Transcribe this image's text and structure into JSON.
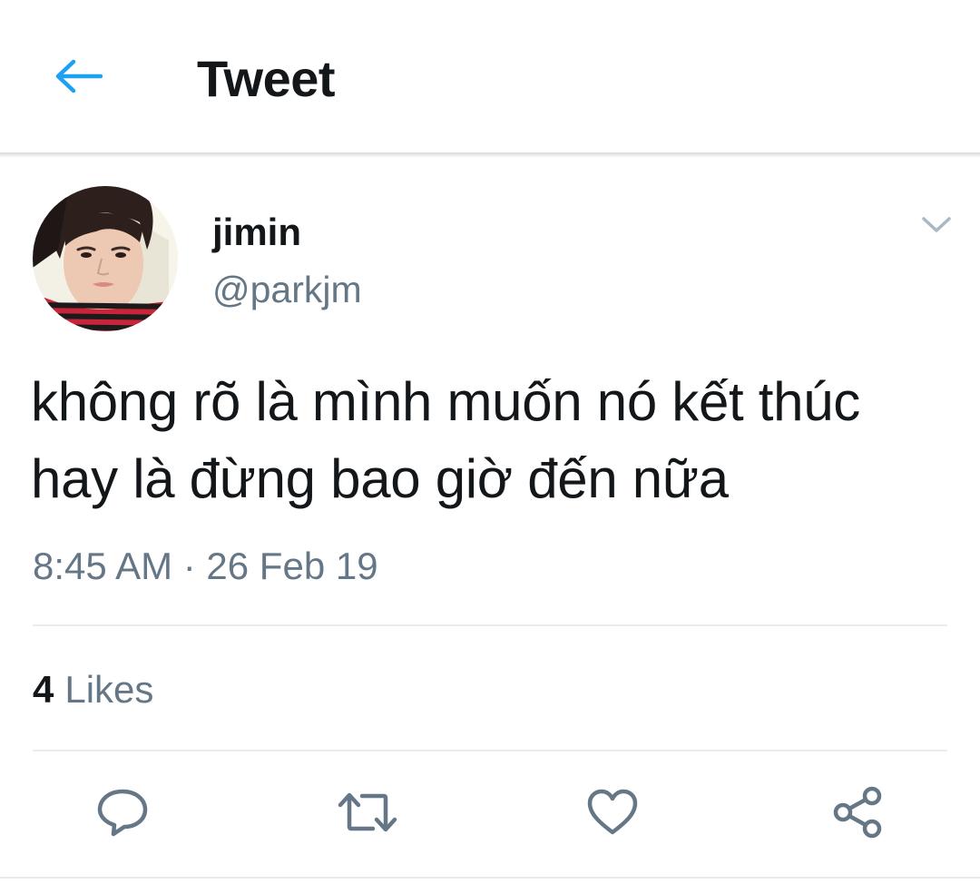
{
  "header": {
    "title": "Tweet",
    "back_icon": "arrow-left-icon",
    "accent_color": "#1da1f2"
  },
  "tweet": {
    "author": {
      "display_name": "jimin",
      "handle": "@parkjm",
      "avatar_icon": "profile-photo"
    },
    "text_lines": [
      "không rõ là mình muốn nó kết thúc",
      "hay là đừng bao giờ đến nữa"
    ],
    "timestamp": "8:45 AM · 26 Feb 19",
    "likes": {
      "count": "4",
      "label": "Likes"
    }
  },
  "actions": {
    "reply_icon": "reply-bubble-icon",
    "retweet_icon": "retweet-icon",
    "like_icon": "heart-icon",
    "share_icon": "share-icon",
    "icon_color": "#657786"
  }
}
